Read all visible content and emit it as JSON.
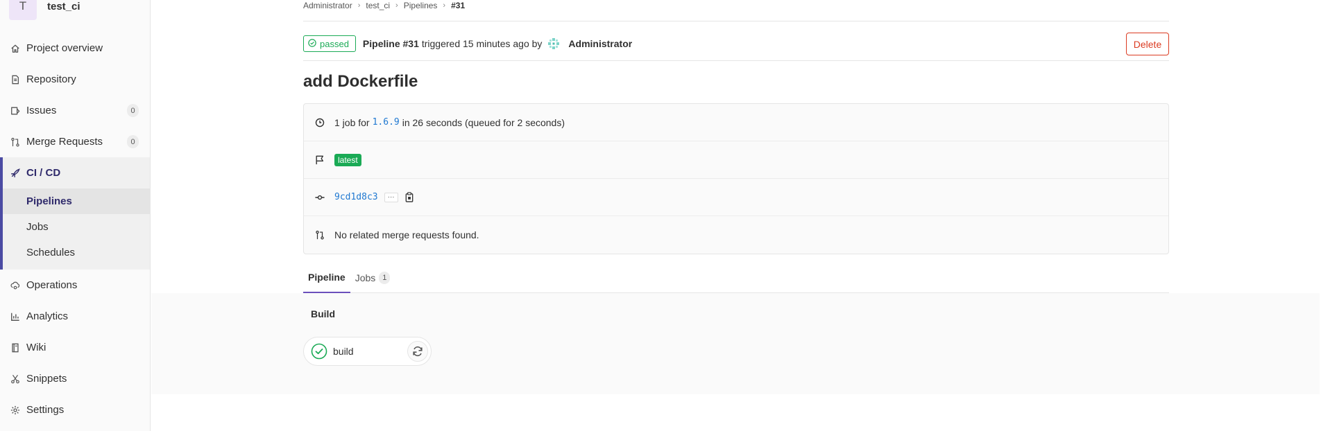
{
  "sidebar": {
    "project_initial": "T",
    "project_name": "test_ci",
    "items": [
      {
        "label": "Project overview",
        "icon": "home-icon"
      },
      {
        "label": "Repository",
        "icon": "doc-icon"
      },
      {
        "label": "Issues",
        "icon": "issues-icon",
        "badge": "0"
      },
      {
        "label": "Merge Requests",
        "icon": "merge-request-icon",
        "badge": "0"
      }
    ],
    "ci": {
      "label": "CI / CD",
      "icon": "rocket-icon",
      "subs": [
        {
          "label": "Pipelines"
        },
        {
          "label": "Jobs"
        },
        {
          "label": "Schedules"
        }
      ]
    },
    "items_after": [
      {
        "label": "Operations",
        "icon": "cloud-gear-icon"
      },
      {
        "label": "Analytics",
        "icon": "chart-icon"
      },
      {
        "label": "Wiki",
        "icon": "book-icon"
      },
      {
        "label": "Snippets",
        "icon": "scissors-icon"
      },
      {
        "label": "Settings",
        "icon": "gear-icon"
      }
    ]
  },
  "breadcrumb": {
    "items": [
      "Administrator",
      "test_ci",
      "Pipelines"
    ],
    "current": "#31"
  },
  "header": {
    "status": "passed",
    "pipeline_label": "Pipeline #31",
    "triggered_text": "triggered 15 minutes ago by",
    "user": "Administrator",
    "delete_label": "Delete"
  },
  "commit_title": "add Dockerfile",
  "info": {
    "jobs_prefix": "1 job for",
    "ref": "1.6.9",
    "jobs_suffix": "in 26 seconds (queued for 2 seconds)",
    "latest_badge": "latest",
    "sha": "9cd1d8c3",
    "ellipsis": "···",
    "merge_requests": "No related merge requests found."
  },
  "tabs": {
    "pipeline": "Pipeline",
    "jobs": "Jobs",
    "jobs_count": "1"
  },
  "graph": {
    "stage": "Build",
    "job": "build"
  },
  "colors": {
    "success": "#1aaa55",
    "danger": "#db3b21",
    "link": "#1f78d1",
    "accent": "#4b4ba3"
  }
}
